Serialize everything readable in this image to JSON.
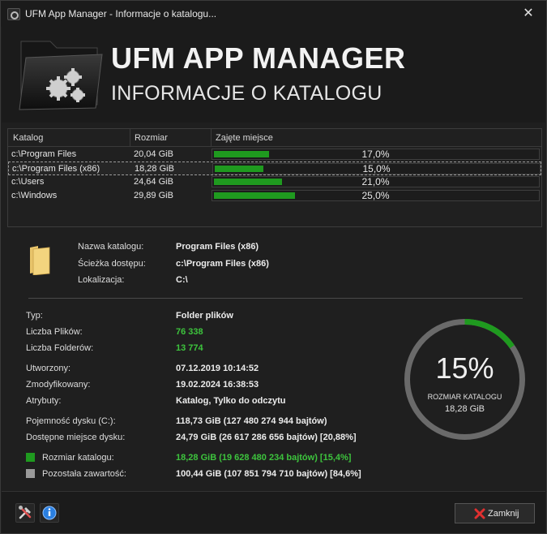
{
  "window": {
    "title": "UFM App Manager - Informacje o katalogu...",
    "close_glyph": "✕"
  },
  "header": {
    "title": "UFM APP MANAGER",
    "subtitle": "INFORMACJE O KATALOGU"
  },
  "list": {
    "columns": [
      "Katalog",
      "Rozmiar",
      "Zajęte miejsce"
    ],
    "rows": [
      {
        "name": "c:\\Program Files",
        "size": "20,04 GiB",
        "pct_text": "17,0%",
        "pct": 0.17,
        "selected": false
      },
      {
        "name": "c:\\Program Files (x86)",
        "size": "18,28 GiB",
        "pct_text": "15,0%",
        "pct": 0.15,
        "selected": true
      },
      {
        "name": "c:\\Users",
        "size": "24,64 GiB",
        "pct_text": "21,0%",
        "pct": 0.21,
        "selected": false
      },
      {
        "name": "c:\\Windows",
        "size": "29,89 GiB",
        "pct_text": "25,0%",
        "pct": 0.25,
        "selected": false
      }
    ]
  },
  "details": {
    "folder_name_label": "Nazwa katalogu:",
    "folder_name": "Program Files (x86)",
    "path_label": "Ścieżka dostępu:",
    "path": "c:\\Program Files (x86)",
    "location_label": "Lokalizacja:",
    "location": "C:\\",
    "type_label": "Typ:",
    "type": "Folder plików",
    "files_label": "Liczba Plików:",
    "files": "76 338",
    "folders_label": "Liczba Folderów:",
    "folders": "13 774",
    "created_label": "Utworzony:",
    "created": "07.12.2019 10:14:52",
    "modified_label": "Zmodyfikowany:",
    "modified": "19.02.2024 16:38:53",
    "attributes_label": "Atrybuty:",
    "attributes": "Katalog, Tylko do odczytu",
    "capacity_label": "Pojemność dysku (C:):",
    "capacity": "118,73 GiB (127 480 274 944 bajtów)",
    "free_label": "Dostępne miejsce dysku:",
    "free": "24,79 GiB (26 617 286 656 bajtów) [20,88%]",
    "folder_size_label": "Rozmiar katalogu:",
    "folder_size": "18,28 GiB (19 628 480 234 bajtów) [15,4%]",
    "rest_label": "Pozostała zawartość:",
    "rest": "100,44 GiB (107 851 794 710 bajtów) [84,6%]"
  },
  "gauge": {
    "percent_text": "15%",
    "fraction": 0.154,
    "label": "ROZMIAR KATALOGU",
    "size": "18,28 GiB"
  },
  "colors": {
    "accent_green": "#1f9a1f",
    "text_green": "#3dc43d",
    "legend_gray": "#9a9a9a",
    "gauge_track": "#6a6a6a"
  },
  "footer": {
    "tools_icon": "tools-icon",
    "info_icon": "info-icon",
    "close_button": "Zamknij",
    "close_underline_char": "Z"
  }
}
